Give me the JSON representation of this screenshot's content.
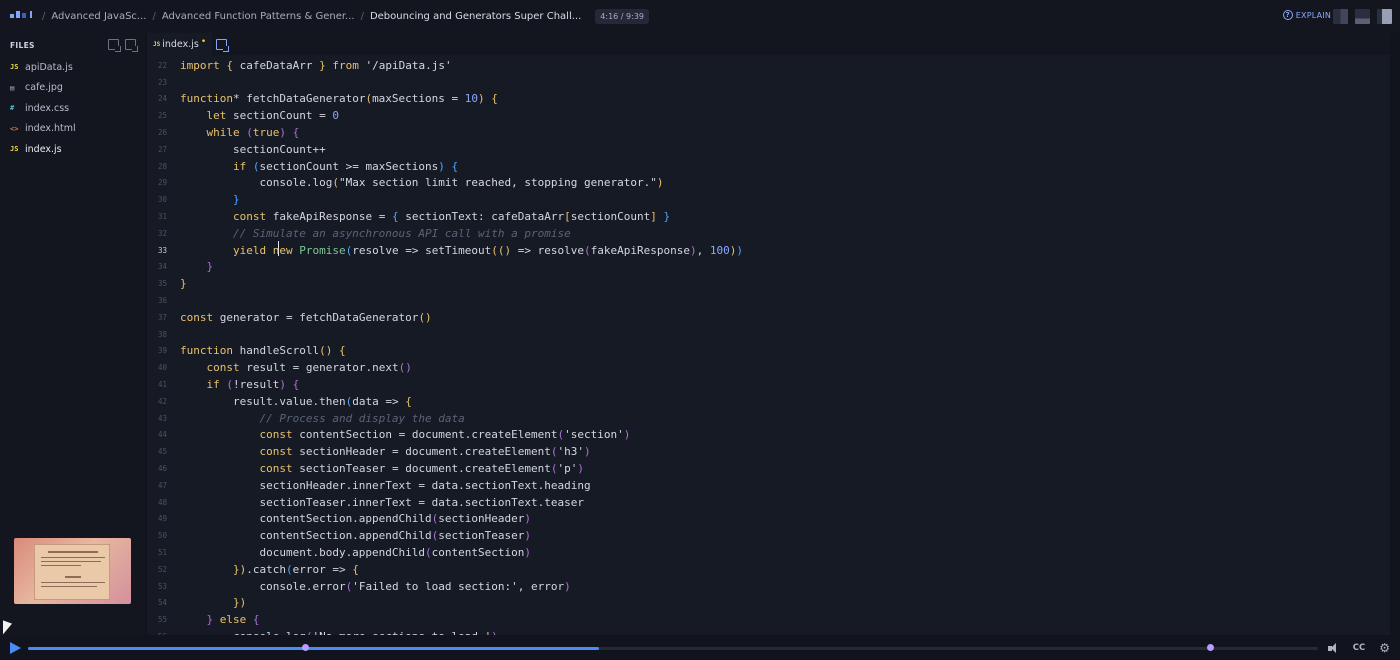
{
  "header": {
    "breadcrumbs": [
      {
        "label": "Advanced JavaSc..."
      },
      {
        "label": "Advanced Function Patterns & Gener..."
      },
      {
        "label": "Debouncing and Generators Super Chall..."
      }
    ],
    "time": "4:16 / 9:39",
    "explain_label": "EXPLAIN"
  },
  "sidebar": {
    "title": "FILES",
    "files": [
      {
        "icon": "JS",
        "name": "apiData.js",
        "type": "js"
      },
      {
        "icon": "▤",
        "name": "cafe.jpg",
        "type": "img"
      },
      {
        "icon": "#",
        "name": "index.css",
        "type": "css"
      },
      {
        "icon": "<>",
        "name": "index.html",
        "type": "html"
      },
      {
        "icon": "JS",
        "name": "index.js",
        "type": "js",
        "active": true
      }
    ]
  },
  "editor": {
    "tab_name": "index.js",
    "tab_icon": "JS",
    "modified_dot": "•",
    "current_line": 33,
    "lines": [
      {
        "n": "22",
        "t": [
          [
            "kw",
            "import "
          ],
          [
            "br1",
            "{ "
          ],
          [
            "code",
            "cafeDataArr "
          ],
          [
            "br1",
            "} "
          ],
          [
            "kw",
            "from "
          ],
          [
            "str",
            "'/apiData.js'"
          ]
        ]
      },
      {
        "n": "23",
        "t": []
      },
      {
        "n": "24",
        "t": [
          [
            "kw",
            "function"
          ],
          [
            "code",
            "* fetchDataGenerator"
          ],
          [
            "br1",
            "("
          ],
          [
            "code",
            "maxSections = "
          ],
          [
            "num",
            "10"
          ],
          [
            "br1",
            ") {"
          ]
        ]
      },
      {
        "n": "25",
        "t": [
          [
            "code",
            "    "
          ],
          [
            "kw",
            "let "
          ],
          [
            "code",
            "sectionCount = "
          ],
          [
            "num",
            "0"
          ]
        ]
      },
      {
        "n": "26",
        "t": [
          [
            "code",
            "    "
          ],
          [
            "kw",
            "while "
          ],
          [
            "br2",
            "("
          ],
          [
            "kw",
            "true"
          ],
          [
            "br2",
            ") {"
          ]
        ]
      },
      {
        "n": "27",
        "t": [
          [
            "code",
            "        sectionCount++"
          ]
        ]
      },
      {
        "n": "28",
        "t": [
          [
            "code",
            "        "
          ],
          [
            "kw",
            "if "
          ],
          [
            "br3",
            "("
          ],
          [
            "code",
            "sectionCount >= maxSections"
          ],
          [
            "br3",
            ") {"
          ]
        ]
      },
      {
        "n": "29",
        "t": [
          [
            "code",
            "            console.log"
          ],
          [
            "br1",
            "("
          ],
          [
            "str",
            "\"Max section limit reached, stopping generator.\""
          ],
          [
            "br1",
            ")"
          ]
        ]
      },
      {
        "n": "30",
        "t": [
          [
            "code",
            "        "
          ],
          [
            "br3",
            "}"
          ]
        ]
      },
      {
        "n": "31",
        "t": [
          [
            "code",
            "        "
          ],
          [
            "kw",
            "const "
          ],
          [
            "code",
            "fakeApiResponse = "
          ],
          [
            "br3",
            "{ "
          ],
          [
            "code",
            "sectionText: cafeDataArr"
          ],
          [
            "br1",
            "["
          ],
          [
            "code",
            "sectionCount"
          ],
          [
            "br1",
            "] "
          ],
          [
            "br3",
            "}"
          ]
        ]
      },
      {
        "n": "32",
        "t": [
          [
            "cm",
            "        // Simulate an asynchronous API call with a promise"
          ]
        ]
      },
      {
        "n": "33",
        "t": [
          [
            "code",
            "        "
          ],
          [
            "kw",
            "yield "
          ],
          [
            "kw",
            "new "
          ],
          [
            "cls",
            "Promise"
          ],
          [
            "br3",
            "("
          ],
          [
            "code",
            "resolve => setTimeout"
          ],
          [
            "br1",
            "(("
          ],
          [
            "br1",
            ") "
          ],
          [
            "code",
            "=> resolve"
          ],
          [
            "br2",
            "("
          ],
          [
            "code",
            "fakeApiResponse"
          ],
          [
            "br2",
            ")"
          ],
          [
            "code",
            ", "
          ],
          [
            "num",
            "100"
          ],
          [
            "br1",
            ")"
          ],
          [
            "br3",
            ")"
          ]
        ]
      },
      {
        "n": "34",
        "t": [
          [
            "code",
            "    "
          ],
          [
            "br2",
            "}"
          ]
        ]
      },
      {
        "n": "35",
        "t": [
          [
            "br1",
            "}"
          ]
        ]
      },
      {
        "n": "36",
        "t": []
      },
      {
        "n": "37",
        "t": [
          [
            "kw",
            "const "
          ],
          [
            "code",
            "generator = fetchDataGenerator"
          ],
          [
            "br1",
            "()"
          ]
        ]
      },
      {
        "n": "38",
        "t": []
      },
      {
        "n": "39",
        "t": [
          [
            "kw",
            "function "
          ],
          [
            "code",
            "handleScroll"
          ],
          [
            "br1",
            "() {"
          ]
        ]
      },
      {
        "n": "40",
        "t": [
          [
            "code",
            "    "
          ],
          [
            "kw",
            "const "
          ],
          [
            "code",
            "result = generator.next"
          ],
          [
            "br2",
            "()"
          ]
        ]
      },
      {
        "n": "41",
        "t": [
          [
            "code",
            "    "
          ],
          [
            "kw",
            "if "
          ],
          [
            "br2",
            "("
          ],
          [
            "code",
            "!result"
          ],
          [
            "br2",
            ") {"
          ]
        ]
      },
      {
        "n": "42",
        "t": [
          [
            "code",
            "        result.value.then"
          ],
          [
            "br3",
            "("
          ],
          [
            "code",
            "data => "
          ],
          [
            "br1",
            "{"
          ]
        ]
      },
      {
        "n": "43",
        "t": [
          [
            "cm",
            "            // Process and display the data"
          ]
        ]
      },
      {
        "n": "44",
        "t": [
          [
            "code",
            "            "
          ],
          [
            "kw",
            "const "
          ],
          [
            "code",
            "contentSection = document.createElement"
          ],
          [
            "br2",
            "("
          ],
          [
            "str",
            "'section'"
          ],
          [
            "br2",
            ")"
          ]
        ]
      },
      {
        "n": "45",
        "t": [
          [
            "code",
            "            "
          ],
          [
            "kw",
            "const "
          ],
          [
            "code",
            "sectionHeader = document.createElement"
          ],
          [
            "br2",
            "("
          ],
          [
            "str",
            "'h3'"
          ],
          [
            "br2",
            ")"
          ]
        ]
      },
      {
        "n": "46",
        "t": [
          [
            "code",
            "            "
          ],
          [
            "kw",
            "const "
          ],
          [
            "code",
            "sectionTeaser = document.createElement"
          ],
          [
            "br2",
            "("
          ],
          [
            "str",
            "'p'"
          ],
          [
            "br2",
            ")"
          ]
        ]
      },
      {
        "n": "47",
        "t": [
          [
            "code",
            "            sectionHeader.innerText = data.sectionText.heading"
          ]
        ]
      },
      {
        "n": "48",
        "t": [
          [
            "code",
            "            sectionTeaser.innerText = data.sectionText.teaser"
          ]
        ]
      },
      {
        "n": "49",
        "t": [
          [
            "code",
            "            contentSection.appendChild"
          ],
          [
            "br2",
            "("
          ],
          [
            "code",
            "sectionHeader"
          ],
          [
            "br2",
            ")"
          ]
        ]
      },
      {
        "n": "50",
        "t": [
          [
            "code",
            "            contentSection.appendChild"
          ],
          [
            "br2",
            "("
          ],
          [
            "code",
            "sectionTeaser"
          ],
          [
            "br2",
            ")"
          ]
        ]
      },
      {
        "n": "51",
        "t": [
          [
            "code",
            "            document.body.appendChild"
          ],
          [
            "br2",
            "("
          ],
          [
            "code",
            "contentSection"
          ],
          [
            "br2",
            ")"
          ]
        ]
      },
      {
        "n": "52",
        "t": [
          [
            "code",
            "        "
          ],
          [
            "br1",
            "})"
          ],
          [
            "code",
            ".catch"
          ],
          [
            "br3",
            "("
          ],
          [
            "code",
            "error => "
          ],
          [
            "br1",
            "{"
          ]
        ]
      },
      {
        "n": "53",
        "t": [
          [
            "code",
            "            console.error"
          ],
          [
            "br2",
            "("
          ],
          [
            "str",
            "'Failed to load section:'"
          ],
          [
            "code",
            ", error"
          ],
          [
            "br2",
            ")"
          ]
        ]
      },
      {
        "n": "54",
        "t": [
          [
            "code",
            "        "
          ],
          [
            "br1",
            "})"
          ]
        ]
      },
      {
        "n": "55",
        "t": [
          [
            "code",
            "    "
          ],
          [
            "br2",
            "} "
          ],
          [
            "kw",
            "else "
          ],
          [
            "br2",
            "{"
          ]
        ]
      },
      {
        "n": "56",
        "t": [
          [
            "code",
            "        console.log"
          ],
          [
            "br2",
            "("
          ],
          [
            "str",
            "'No more sections to load.'"
          ],
          [
            "br2",
            ")"
          ]
        ]
      }
    ]
  },
  "player": {
    "progress": 0.443,
    "markers": [
      0.215,
      0.917
    ],
    "cc_label": "CC",
    "gear_glyph": "⚙"
  },
  "colors": {
    "accent": "#4a8cf5",
    "keyword": "#e8c16b",
    "bracket_purple": "#b06fd6",
    "bracket_blue": "#4da6ff",
    "comment": "#5c6378"
  }
}
